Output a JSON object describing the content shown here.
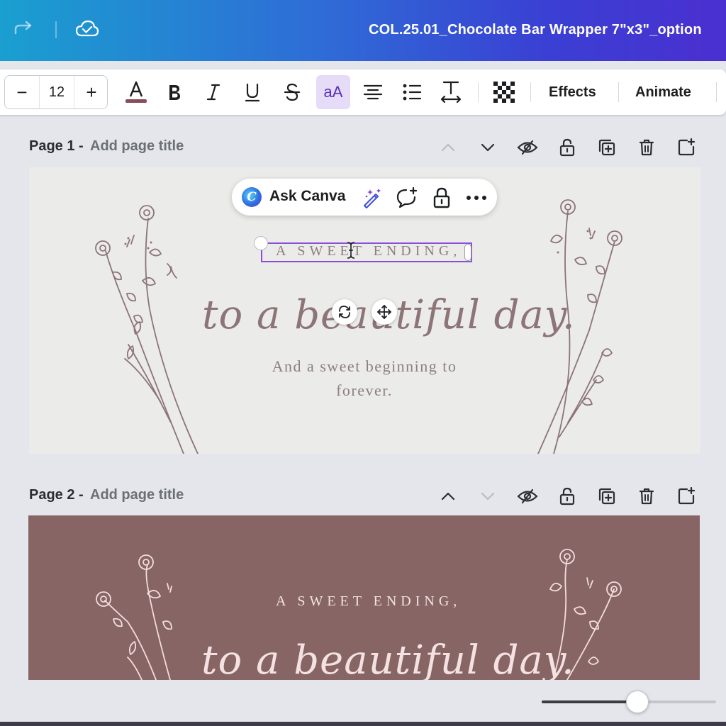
{
  "header": {
    "doc_title": "COL.25.01_Chocolate Bar Wrapper 7\"x3\"_option",
    "icons": [
      "redo-icon",
      "cloud-saved-icon"
    ]
  },
  "toolbar": {
    "font_size": "12",
    "decrease_label": "−",
    "increase_label": "+",
    "effects_label": "Effects",
    "animate_label": "Animate",
    "text_color": "#8a4b5a",
    "active_button": "case-toggle",
    "case_label": "aA"
  },
  "pages": [
    {
      "label": "Page 1 -",
      "title_placeholder": "Add page title",
      "background": "#ebebea",
      "heading": "A SWEET ENDING,",
      "script": "to a beautiful day.",
      "subtext_line1": "And a sweet beginning to",
      "subtext_line2": "forever."
    },
    {
      "label": "Page 2 -",
      "title_placeholder": "Add page title",
      "background": "#886565",
      "heading": "A SWEET ENDING,",
      "script": "to a beautiful day."
    }
  ],
  "ask_canva": {
    "label": "Ask Canva",
    "logo_letter": "C"
  },
  "zoom": {
    "level_fraction": 0.55
  },
  "colors": {
    "accent_purple": "#8b4fd8",
    "floral_page1": "#8d7477",
    "floral_page2": "#f2dcdc",
    "text_page1": "#8d7e7f",
    "text_page2": "#f4e2e2"
  }
}
